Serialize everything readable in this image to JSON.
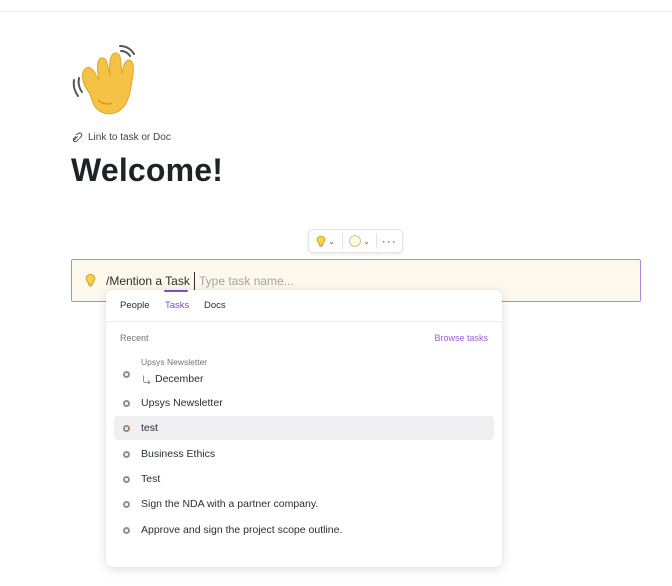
{
  "page": {
    "link_label": "Link to task or Doc",
    "title": "Welcome!",
    "wave_icon": "waving-hand-emoji"
  },
  "toolbar": {
    "icon_button": "lightbulb-icon",
    "color_button": "color-circle-icon",
    "more_button": "more-horizontal-icon"
  },
  "callout": {
    "command_prefix": "/Mention a ",
    "command_word": "Task",
    "placeholder": "Type task name...",
    "bg_color": "#fdf8ec",
    "border_color": "#b18ad6"
  },
  "mention_menu": {
    "tabs": [
      "People",
      "Tasks",
      "Docs"
    ],
    "active_tab": "Tasks",
    "section_label": "Recent",
    "browse_label": "Browse tasks",
    "accent": "#7b4fc4",
    "subtask_group": {
      "parent": "Upsys Newsletter",
      "child": "December"
    },
    "items": [
      {
        "label": "Upsys Newsletter",
        "status_color": "#8c9096",
        "highlighted": false
      },
      {
        "label": "test",
        "status_color": "#a3847a",
        "highlighted": true
      },
      {
        "label": "Business Ethics",
        "status_color": "#8c9096",
        "highlighted": false
      },
      {
        "label": "Test",
        "status_color": "#8c9096",
        "highlighted": false
      },
      {
        "label": "Sign the NDA with a partner company.",
        "status_color": "#8c9096",
        "highlighted": false
      },
      {
        "label": "Approve and sign the project scope outline.",
        "status_color": "#8c9096",
        "highlighted": false
      }
    ]
  }
}
